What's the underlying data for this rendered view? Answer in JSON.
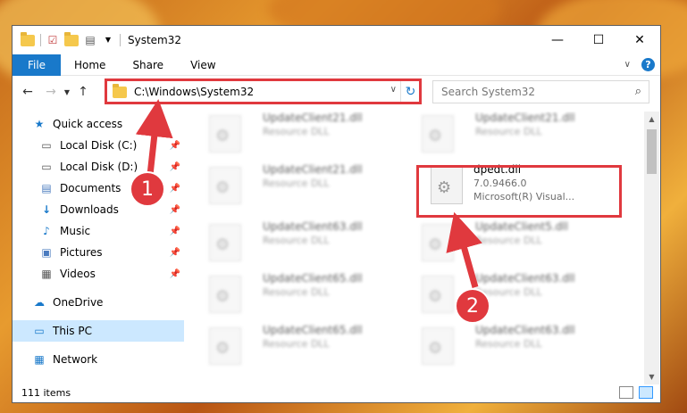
{
  "window": {
    "title": "System32",
    "controls": [
      "minimize",
      "maximize",
      "close"
    ]
  },
  "ribbon": {
    "file_tab": "File",
    "tabs": [
      "Home",
      "Share",
      "View"
    ]
  },
  "address_bar": {
    "path": "C:\\Windows\\System32"
  },
  "search": {
    "placeholder": "Search System32"
  },
  "nav_pane": {
    "items": [
      {
        "label": "Quick access",
        "icon": "star-icon"
      },
      {
        "label": "Local Disk (C:)",
        "icon": "drive-icon",
        "pinned": true
      },
      {
        "label": "Local Disk (D:)",
        "icon": "drive-icon",
        "pinned": true
      },
      {
        "label": "Documents",
        "icon": "documents-icon",
        "pinned": true
      },
      {
        "label": "Downloads",
        "icon": "download-icon",
        "pinned": true
      },
      {
        "label": "Music",
        "icon": "music-icon",
        "pinned": true
      },
      {
        "label": "Pictures",
        "icon": "pictures-icon",
        "pinned": true
      },
      {
        "label": "Videos",
        "icon": "videos-icon",
        "pinned": true
      },
      {
        "label": "OneDrive",
        "icon": "cloud-icon"
      },
      {
        "label": "This PC",
        "icon": "computer-icon",
        "selected": true
      },
      {
        "label": "Network",
        "icon": "network-icon"
      }
    ]
  },
  "files": [
    {
      "name": "UpdateClient21.dll",
      "sub": "Resource DLL",
      "blurred": true
    },
    {
      "name": "UpdateClient21.dll",
      "sub": "Resource DLL",
      "blurred": true
    },
    {
      "name": "UpdateClient21.dll",
      "sub": "Resource DLL",
      "blurred": true
    },
    {
      "name": "dpedt.dll",
      "version": "7.0.9466.0",
      "company": "Microsoft(R) Visual...",
      "blurred": false
    },
    {
      "name": "UpdateClient63.dll",
      "sub": "Resource DLL",
      "blurred": true
    },
    {
      "name": "UpdateClient5.dll",
      "sub": "Resource DLL",
      "blurred": true
    },
    {
      "name": "UpdateClient65.dll",
      "sub": "Resource DLL",
      "blurred": true
    },
    {
      "name": "UpdateClient63.dll",
      "sub": "Resource DLL",
      "blurred": true
    },
    {
      "name": "UpdateClient65.dll",
      "sub": "Resource DLL",
      "blurred": true
    },
    {
      "name": "UpdateClient63.dll",
      "sub": "Resource DLL",
      "blurred": true
    }
  ],
  "status": {
    "item_count": "111 items"
  },
  "annotations": {
    "callout_1": "1",
    "callout_2": "2",
    "color": "#e0393e"
  }
}
